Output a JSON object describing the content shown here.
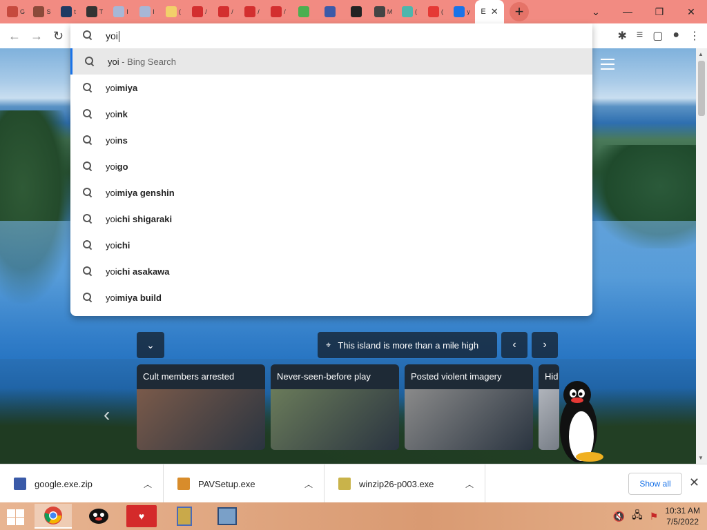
{
  "tabs": [
    {
      "favicon_color": "#c64a3e",
      "label": "G"
    },
    {
      "favicon_color": "#8b4a3a",
      "label": "S"
    },
    {
      "favicon_color": "#1f3a63",
      "label": "t"
    },
    {
      "favicon_color": "#333333",
      "label": "T"
    },
    {
      "favicon_color": "#a7b7d6",
      "label": "I"
    },
    {
      "favicon_color": "#a7b7d6",
      "label": "I"
    },
    {
      "favicon_color": "#f2d06a",
      "label": "("
    },
    {
      "favicon_color": "#d32f2f",
      "label": "/"
    },
    {
      "favicon_color": "#d32f2f",
      "label": "/"
    },
    {
      "favicon_color": "#d32f2f",
      "label": "/"
    },
    {
      "favicon_color": "#d32f2f",
      "label": "/"
    },
    {
      "favicon_color": "#4caf50",
      "label": ""
    },
    {
      "favicon_color": "#3c5aa8",
      "label": ""
    },
    {
      "favicon_color": "#222222",
      "label": ""
    },
    {
      "favicon_color": "#444444",
      "label": "M"
    },
    {
      "favicon_color": "#4db6ac",
      "label": "("
    },
    {
      "favicon_color": "#e53935",
      "label": "("
    },
    {
      "favicon_color": "#1a73e8",
      "label": "y"
    }
  ],
  "active_tab": {
    "label": "E"
  },
  "window_controls": {
    "minimize": "—",
    "maximize": "❐",
    "close": "✕",
    "tabmenu": "⌄"
  },
  "omnibox": {
    "value": "yoi",
    "suggestions": [
      {
        "typed": "yoi",
        "rest": "",
        "sub": " - Bing Search",
        "selected": true
      },
      {
        "typed": "yoi",
        "rest": "miya"
      },
      {
        "typed": "yoi",
        "rest": "nk"
      },
      {
        "typed": "yoi",
        "rest": "ns"
      },
      {
        "typed": "yoi",
        "rest": "go"
      },
      {
        "typed": "yoi",
        "rest": "miya genshin"
      },
      {
        "typed": "yoi",
        "rest": "chi shigaraki"
      },
      {
        "typed": "yoi",
        "rest": "chi"
      },
      {
        "typed": "yoi",
        "rest": "chi asakawa"
      },
      {
        "typed": "yoi",
        "rest": "miya build"
      }
    ]
  },
  "bing": {
    "location_text": "This island is more than a mile high",
    "cards": [
      {
        "title": "Cult members arrested",
        "color": "#7a5a4a"
      },
      {
        "title": "Never-seen-before play",
        "color": "#6a7b5a"
      },
      {
        "title": "Posted violent imagery",
        "color": "#8a8a8a"
      },
      {
        "title": "Hid",
        "color": "#b0b4bb"
      }
    ]
  },
  "downloads": {
    "items": [
      {
        "name": "google.exe.zip",
        "icon_color": "#3a5aa8"
      },
      {
        "name": "PAVSetup.exe",
        "icon_color": "#d88c2b"
      },
      {
        "name": "winzip26-p003.exe",
        "icon_color": "#c9b34a"
      }
    ],
    "show_all": "Show all"
  },
  "taskbar": {
    "time": "10:31 AM",
    "date": "7/5/2022"
  }
}
